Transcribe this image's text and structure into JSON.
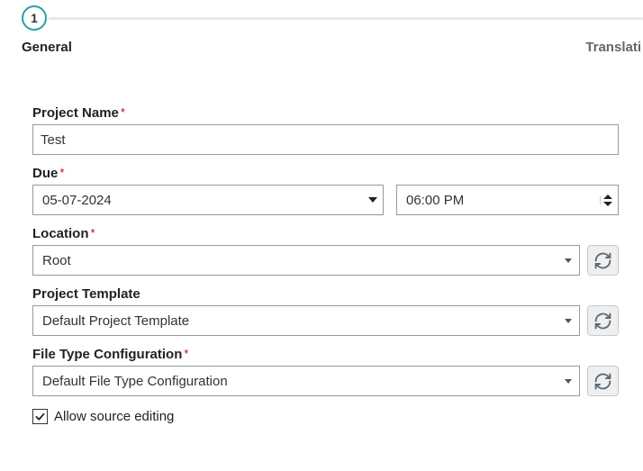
{
  "stepper": {
    "step_number": "1"
  },
  "tabs": {
    "general": "General",
    "translati": "Translati"
  },
  "form": {
    "project_name": {
      "label": "Project Name",
      "value": "Test"
    },
    "due": {
      "label": "Due",
      "date": "05-07-2024",
      "time": "06:00 PM"
    },
    "location": {
      "label": "Location",
      "value": "Root"
    },
    "project_template": {
      "label": "Project Template",
      "value": "Default Project Template"
    },
    "file_type_config": {
      "label": "File Type Configuration",
      "value": "Default File Type Configuration"
    },
    "allow_source_editing": {
      "label": "Allow source editing",
      "checked": true
    }
  }
}
